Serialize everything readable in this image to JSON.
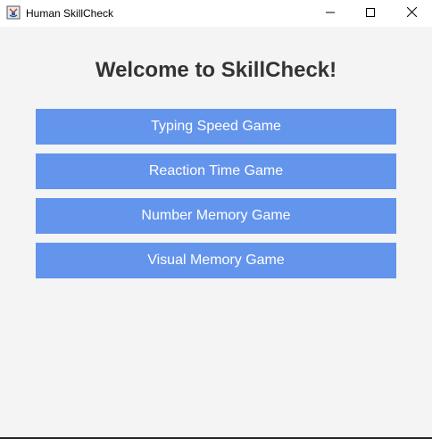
{
  "window": {
    "title": "Human SkillCheck",
    "icon": "java-app-icon",
    "controls": [
      "minimize-icon",
      "maximize-icon",
      "close-icon"
    ]
  },
  "main": {
    "heading": "Welcome to SkillCheck!",
    "buttons": [
      {
        "label": "Typing Speed Game"
      },
      {
        "label": "Reaction Time Game"
      },
      {
        "label": "Number Memory Game"
      },
      {
        "label": "Visual Memory Game"
      }
    ]
  },
  "colors": {
    "button_bg": "#6495ed",
    "button_text": "#ffffff",
    "heading_text": "#333333",
    "background": "#f4f4f4"
  }
}
